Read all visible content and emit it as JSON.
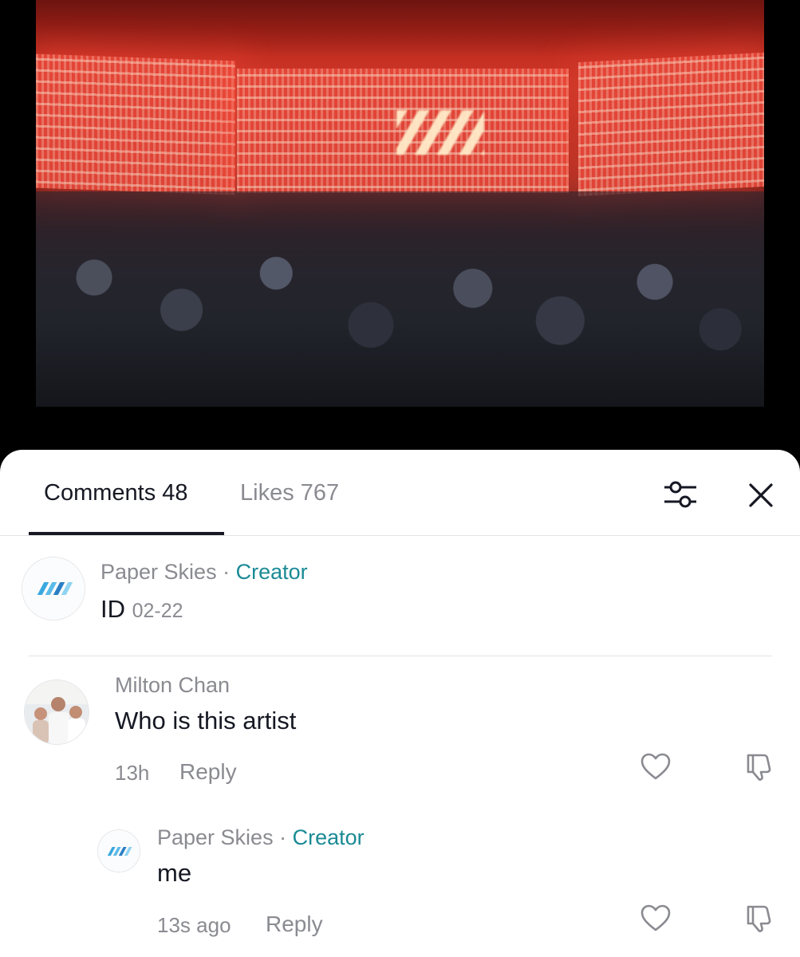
{
  "tabs": {
    "comments_label": "Comments 48",
    "likes_label": "Likes 767"
  },
  "icons": {
    "filter": "sliders-icon",
    "close": "close-icon",
    "like": "heart-icon",
    "dislike": "thumbs-down-icon"
  },
  "colors": {
    "creator": "#1a8a95",
    "muted": "#8a8b91",
    "text": "#161823"
  },
  "comments": [
    {
      "author": "Paper Skies",
      "separator": "·",
      "badge": "Creator",
      "text": "ID",
      "date": "02-22"
    },
    {
      "author": "Milton Chan",
      "text": "Who is this artist",
      "time": "13h",
      "reply_label": "Reply",
      "replies": [
        {
          "author": "Paper Skies",
          "separator": "·",
          "badge": "Creator",
          "text": "me",
          "time": "13s ago",
          "reply_label": "Reply"
        }
      ]
    }
  ]
}
